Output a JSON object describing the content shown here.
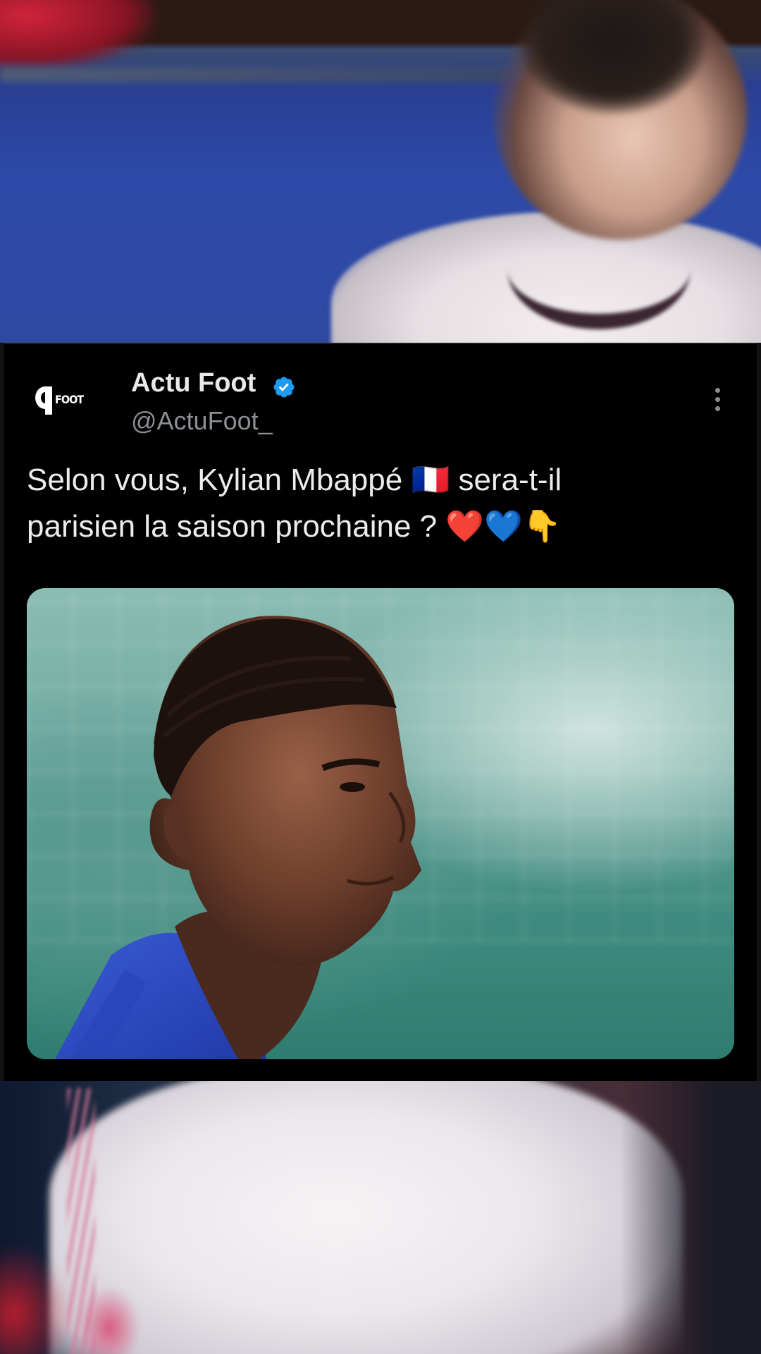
{
  "tweet": {
    "account_name": "Actu Foot",
    "handle": "@ActuFoot_",
    "verified": true,
    "avatar_brand": "FOOT",
    "text": "Selon vous, Kylian Mbappé 🇫🇷 sera-t-il\nparisien la saison prochaine ? ❤️💙👇"
  },
  "icons": {
    "verified": "verified-badge-icon",
    "more": "more-options-icon"
  },
  "colors": {
    "card_background": "#000000",
    "name_text": "#e7e9ea",
    "handle_text": "#8b8f93",
    "verified_badge": "#1d9bf0",
    "background_kit_blue": "#2d4aa8"
  }
}
